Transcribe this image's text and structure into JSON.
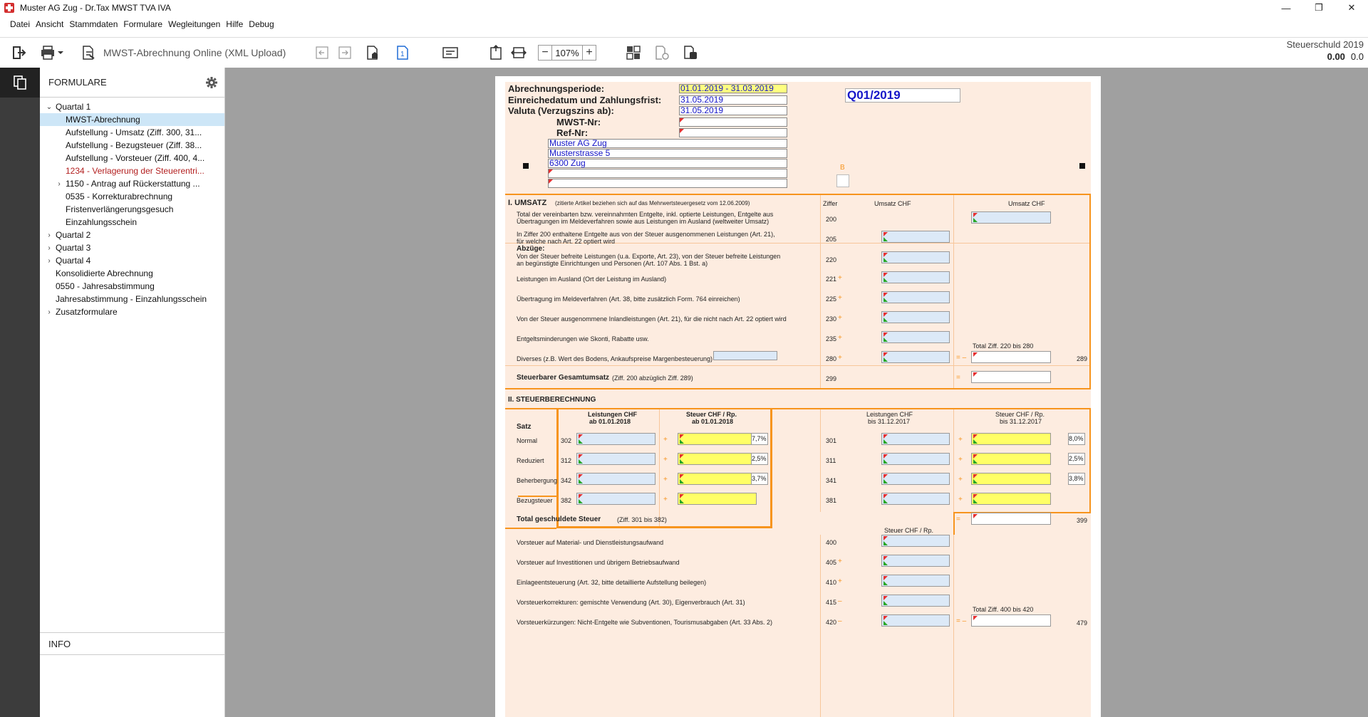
{
  "window": {
    "title": "Muster AG Zug - Dr.Tax MWST TVA IVA",
    "min": "—",
    "max": "❐",
    "close": "✕"
  },
  "menu": [
    "Datei",
    "Ansicht",
    "Stammdaten",
    "Formulare",
    "Wegleitungen",
    "Hilfe",
    "Debug"
  ],
  "toolbar": {
    "form_label": "MWST-Abrechnung Online (XML Upload)",
    "zoom": "107%",
    "zoom_minus": "−",
    "zoom_plus": "+",
    "page_num": "1"
  },
  "tax": {
    "label": "Steuerschuld 2019",
    "value1": "0.00",
    "value2": "0.0"
  },
  "sidebar": {
    "title": "FORMULARE",
    "info_title": "INFO",
    "items": [
      {
        "label": "Quartal 1",
        "indent": 1,
        "chev": "⌄"
      },
      {
        "label": "MWST-Abrechnung",
        "indent": 2,
        "chev": "",
        "selected": true
      },
      {
        "label": "Aufstellung - Umsatz (Ziff. 300, 31...",
        "indent": 2,
        "chev": ""
      },
      {
        "label": "Aufstellung - Bezugsteuer (Ziff. 38...",
        "indent": 2,
        "chev": ""
      },
      {
        "label": "Aufstellung - Vorsteuer (Ziff. 400, 4...",
        "indent": 2,
        "chev": ""
      },
      {
        "label": "1234 - Verlagerung der Steuerentri...",
        "indent": 2,
        "chev": "",
        "red": true
      },
      {
        "label": "1150 - Antrag auf Rückerstattung ...",
        "indent": 2,
        "chev": "›"
      },
      {
        "label": "0535 - Korrekturabrechnung",
        "indent": 2,
        "chev": ""
      },
      {
        "label": "Fristenverlängerungsgesuch",
        "indent": 2,
        "chev": ""
      },
      {
        "label": "Einzahlungsschein",
        "indent": 2,
        "chev": ""
      },
      {
        "label": "Quartal 2",
        "indent": 1,
        "chev": "›"
      },
      {
        "label": "Quartal 3",
        "indent": 1,
        "chev": "›"
      },
      {
        "label": "Quartal 4",
        "indent": 1,
        "chev": "›"
      },
      {
        "label": "Konsolidierte Abrechnung",
        "indent": 1,
        "chev": ""
      },
      {
        "label": "0550 - Jahresabstimmung",
        "indent": 1,
        "chev": ""
      },
      {
        "label": "Jahresabstimmung - Einzahlungsschein",
        "indent": 1,
        "chev": ""
      },
      {
        "label": "Zusatzformulare",
        "indent": 1,
        "chev": "›"
      }
    ]
  },
  "form": {
    "hdr": {
      "periode_label": "Abrechnungsperiode:",
      "periode": "01.01.2019 - 31.03.2019",
      "frist_label": "Einreichedatum und Zahlungsfrist:",
      "frist": "31.05.2019",
      "valuta_label": "Valuta (Verzugszins ab):",
      "valuta": "31.05.2019",
      "mwst_label": "MWST-Nr:",
      "ref_label": "Ref-Nr:",
      "addr1": "Muster AG Zug",
      "addr2": "Musterstrasse 5",
      "addr3": "6300 Zug",
      "b": "B",
      "q": "Q01/2019"
    },
    "s1": {
      "title": "I.  UMSATZ",
      "note": "(zitierte Artikel beziehen sich auf das Mehrwertsteuergesetz vom 12.06.2009)",
      "col_ziffer": "Ziffer",
      "col_umsatz1": "Umsatz CHF",
      "col_umsatz2": "Umsatz CHF",
      "r200a": "Total der vereinbarten bzw. vereinnahmten Entgelte, inkl. optierte Leistungen, Entgelte aus",
      "r200b": "Übertragungen im Meldeverfahren sowie aus Leistungen im Ausland (weltweiter Umsatz)",
      "r205a": "In Ziffer 200 enthaltene Entgelte aus von der Steuer ausgenommenen Leistungen (Art. 21),",
      "r205b": "für welche nach Art. 22 optiert wird",
      "abz": "Abzüge:",
      "r220a": "Von der Steuer befreite Leistungen (u.a. Exporte, Art. 23), von der Steuer befreite Leistungen",
      "r220b": "an begünstigte Einrichtungen und Personen (Art. 107 Abs. 1 Bst. a)",
      "r221": "Leistungen im Ausland (Ort der Leistung im Ausland)",
      "r225": "Übertragung im Meldeverfahren (Art. 38, bitte zusätzlich Form. 764 einreichen)",
      "r230": "Von der Steuer ausgenommene Inlandleistungen (Art. 21), für die nicht nach Art. 22 optiert wird",
      "r235": "Entgeltsminderungen wie Skonti, Rabatte usw.",
      "r280": "Diverses (z.B. Wert des Bodens, Ankaufspreise Margenbesteuerung)",
      "total220": "Total Ziff. 220 bis 280",
      "r299": "Steuerbarer Gesamtumsatz",
      "r299n": "(Ziff. 200 abzüglich Ziff. 289)",
      "z200": "200",
      "z205": "205",
      "z220": "220",
      "z221": "221",
      "z225": "225",
      "z230": "230",
      "z235": "235",
      "z280": "280",
      "z289": "289",
      "z299": "299"
    },
    "s2": {
      "title": "II.  STEUERBERECHNUNG",
      "satz": "Satz",
      "c1a": "Leistungen CHF",
      "c1b": "ab 01.01.2018",
      "c2a": "Steuer CHF / Rp.",
      "c2b": "ab 01.01.2018",
      "c3a": "Leistungen CHF",
      "c3b": "bis 31.12.2017",
      "c4a": "Steuer CHF / Rp.",
      "c4b": "bis 31.12.2017",
      "normal": "Normal",
      "reduziert": "Reduziert",
      "beherbergung": "Beherbergung",
      "bezug": "Bezugsteuer",
      "z302": "302",
      "z312": "312",
      "z342": "342",
      "z382": "382",
      "z301": "301",
      "z311": "311",
      "z341": "341",
      "z381": "381",
      "p1": "7,7%",
      "p2": "2,5%",
      "p3": "3,7%",
      "p4": "8,0%",
      "p5": "2,5%",
      "p6": "3,8%",
      "total": "Total geschuldete Steuer",
      "total_n": "(Ziff. 301 bis 382)",
      "z399": "399",
      "steuer_col": "Steuer CHF / Rp.",
      "r400": "Vorsteuer auf Material- und Dienstleistungsaufwand",
      "r405": "Vorsteuer auf Investitionen und übrigem Betriebsaufwand",
      "r410": "Einlageentsteuerung (Art. 32, bitte detaillierte Aufstellung beilegen)",
      "r415": "Vorsteuerkorrekturen: gemischte Verwendung (Art. 30), Eigenverbrauch (Art. 31)",
      "r420": "Vorsteuerkürzungen: Nicht-Entgelte wie Subventionen, Tourismusabgaben (Art. 33 Abs. 2)",
      "total400": "Total Ziff. 400 bis 420",
      "z400": "400",
      "z405": "405",
      "z410": "410",
      "z415": "415",
      "z420": "420",
      "z479": "479"
    },
    "ops": {
      "plus": "+",
      "minus": "–",
      "eq": "=",
      "eqm": "= –"
    }
  }
}
